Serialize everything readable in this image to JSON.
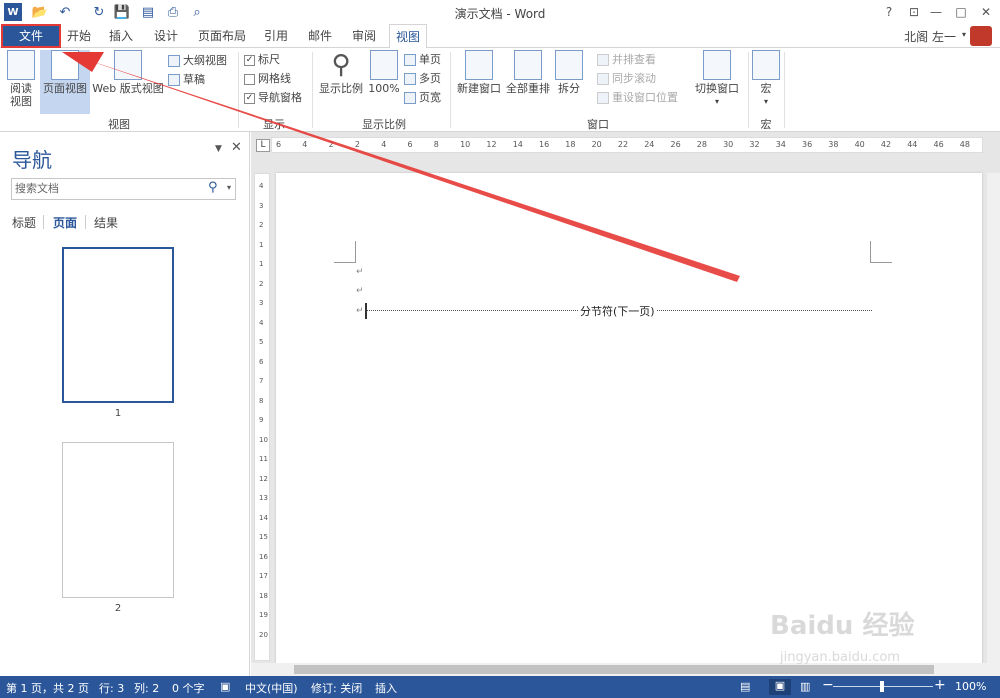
{
  "window": {
    "title": "演示文档 - Word",
    "help": "?",
    "controls": {
      "restore_ribbon": "⊡",
      "minimize": "—",
      "maximize": "□",
      "close": "✕"
    }
  },
  "qat": {
    "app_icon": "word-app-icon",
    "open": "📂",
    "undo": "↶",
    "redo": "↻",
    "save": "💾"
  },
  "tabs": [
    "文件",
    "开始",
    "插入",
    "设计",
    "页面布局",
    "引用",
    "邮件",
    "审阅",
    "视图"
  ],
  "active_tab": "视图",
  "user": {
    "name": "北阁 左一"
  },
  "ribbon": {
    "views": {
      "label": "视图",
      "read_mode": "阅读\n视图",
      "print_layout": "页面视图",
      "web_layout": "Web 版式视图",
      "outline": "大纲视图",
      "draft": "草稿"
    },
    "show": {
      "label": "显示",
      "ruler": "标尺",
      "ruler_checked": true,
      "gridlines": "网格线",
      "gridlines_checked": false,
      "nav_pane": "导航窗格",
      "nav_pane_checked": true
    },
    "zoom": {
      "label": "显示比例",
      "zoom": "显示比例",
      "hundred": "100%",
      "one_page": "单页",
      "multiple_pages": "多页",
      "page_width": "页宽"
    },
    "window": {
      "label": "窗口",
      "new_window": "新建窗口",
      "arrange_all": "全部重排",
      "split": "拆分",
      "side_by_side": "并排查看",
      "sync_scroll": "同步滚动",
      "reset_position": "重设窗口位置",
      "switch_windows": "切换窗口"
    },
    "macros": {
      "label": "宏",
      "macros": "宏"
    }
  },
  "nav": {
    "title": "导航",
    "search_placeholder": "搜索文档",
    "tabs": [
      "标题",
      "页面",
      "结果"
    ],
    "active_tab": "页面",
    "pages": [
      "1",
      "2"
    ]
  },
  "ruler": {
    "h_ticks": [
      "6",
      "4",
      "2",
      "2",
      "4",
      "6",
      "8",
      "10",
      "12",
      "14",
      "16",
      "18",
      "20",
      "22",
      "24",
      "26",
      "28",
      "30",
      "32",
      "34",
      "36",
      "38",
      "40",
      "42",
      "44",
      "46",
      "48"
    ],
    "v_ticks": [
      "4",
      "3",
      "2",
      "1",
      "1",
      "2",
      "3",
      "4",
      "5",
      "6",
      "7",
      "8",
      "9",
      "10",
      "11",
      "12",
      "13",
      "14",
      "15",
      "16",
      "17",
      "18",
      "19",
      "20"
    ]
  },
  "document": {
    "section_break": "分节符(下一页)",
    "para_mark": "↵"
  },
  "status": {
    "page": "第 1 页，共 2 页",
    "line": "行: 3",
    "column": "列: 2",
    "words": "0 个字",
    "language": "中文(中国)",
    "track": "修订: 关闭",
    "mode": "插入",
    "zoom_minus": "−",
    "zoom_plus": "+",
    "zoom": "100%"
  },
  "watermark": {
    "brand": "Baidu 经验",
    "url": "jingyan.baidu.com"
  },
  "colors": {
    "accent": "#2b579a",
    "highlight": "#e53935",
    "arrow": "#e53935"
  }
}
